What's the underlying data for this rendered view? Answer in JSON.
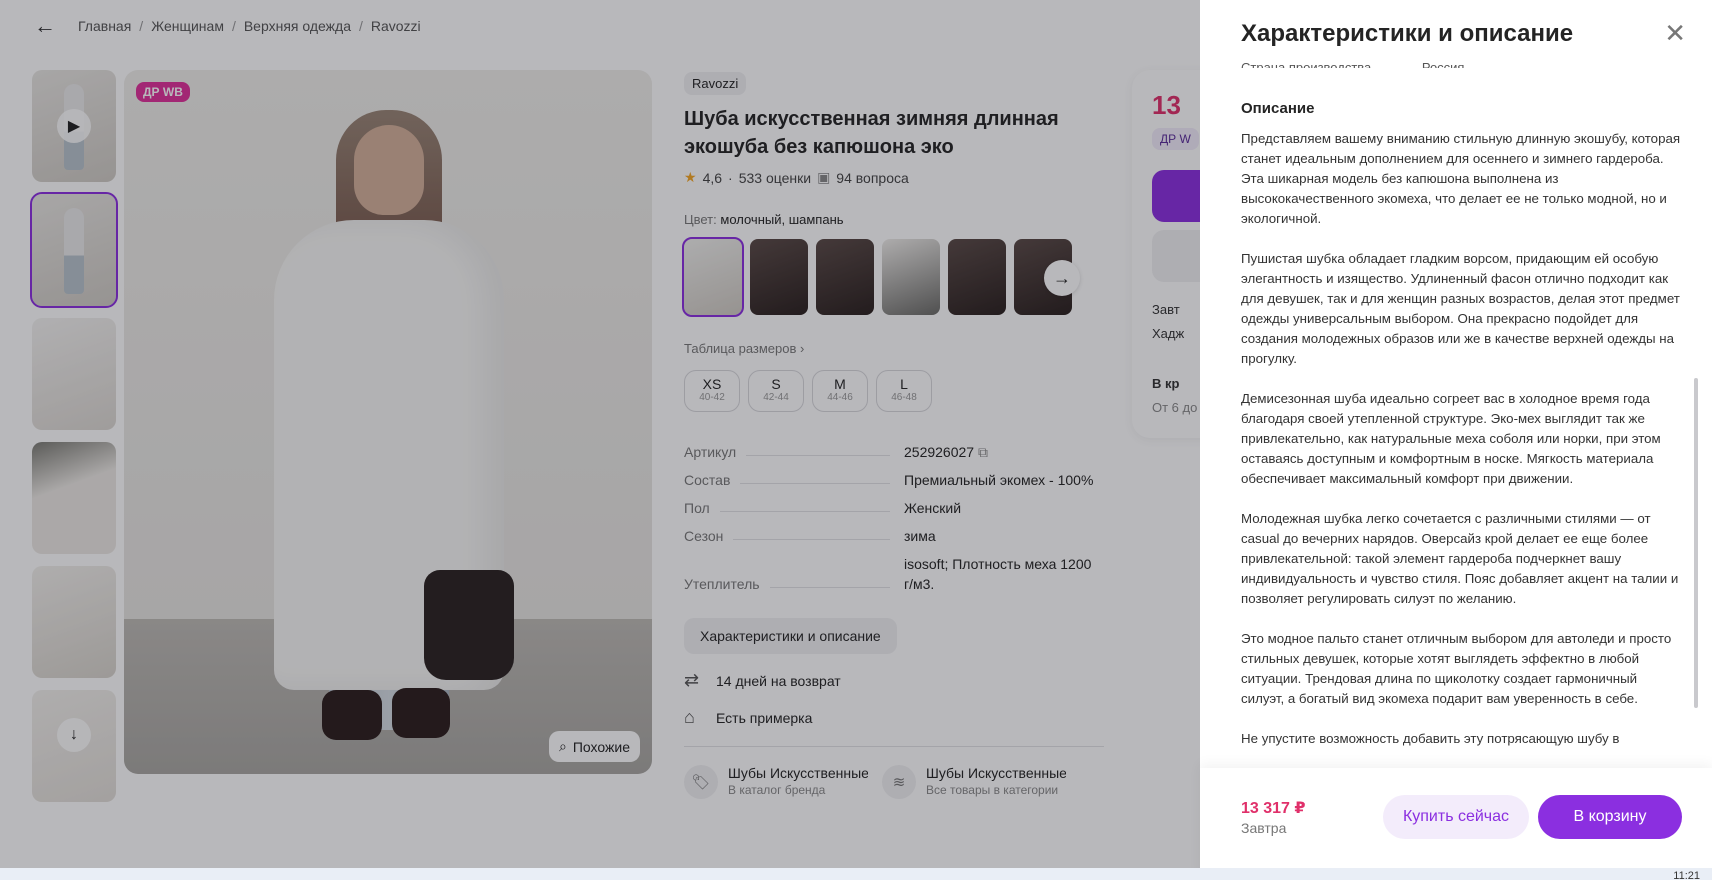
{
  "breadcrumb": [
    "Главная",
    "Женщинам",
    "Верхняя одежда",
    "Ravozzi"
  ],
  "gallery": {
    "badge": "ДР WB",
    "similar_label": "Похожие"
  },
  "product": {
    "brand": "Ravozzi",
    "title": "Шуба искусственная зимняя длинная экошуба без капюшона эко",
    "rating": "4,6",
    "reviews": "533 оценки",
    "questions": "94 вопроса",
    "color_label": "Цвет:",
    "color_value": "молочный, шампань",
    "size_table_label": "Таблица размеров",
    "sizes": [
      {
        "name": "XS",
        "range": "40-42"
      },
      {
        "name": "S",
        "range": "42-44"
      },
      {
        "name": "M",
        "range": "44-46"
      },
      {
        "name": "L",
        "range": "46-48"
      }
    ],
    "specs": [
      {
        "key": "Артикул",
        "value": "252926027"
      },
      {
        "key": "Состав",
        "value": "Премиальный экомех - 100%"
      },
      {
        "key": "Пол",
        "value": "Женский"
      },
      {
        "key": "Сезон",
        "value": "зима"
      },
      {
        "key": "Утеплитель",
        "value": "isosoft; Плотность меха 1200 г/м3."
      }
    ],
    "char_button": "Характеристики и описание",
    "perks": [
      "14 дней на возврат",
      "Есть примерка"
    ],
    "categories": [
      {
        "title": "Шубы Искусственные R",
        "sub": "В каталог бренда"
      },
      {
        "title": "Шубы Искусственные",
        "sub": "Все товары в категории"
      }
    ]
  },
  "buy_card": {
    "price_fragment": "13",
    "dr_fragment": "ДР W",
    "line1": "Завт",
    "line2": "Хадж",
    "line3": "В кр",
    "line4": "От 6 до"
  },
  "panel": {
    "title": "Характеристики и описание",
    "cut_line": "Страна производства ............ Россия",
    "section_title": "Описание",
    "paragraphs": [
      "Представляем вашему вниманию стильную длинную экошубу, которая станет идеальным дополнением для осеннего и зимнего гардероба. Эта шикарная модель без капюшона выполнена из высококачественного экомеха, что делает ее не только модной, но и экологичной.",
      "Пушистая шубка обладает гладким ворсом, придающим ей особую элегантность и изящество. Удлиненный фасон отлично подходит как для девушек, так и для женщин разных возрастов, делая этот предмет одежды универсальным выбором. Она прекрасно подойдет для создания молодежных образов или же в качестве верхней одежды на прогулку.",
      "Демисезонная шуба идеально согреет вас в холодное время года благодаря своей утепленной структуре. Эко-мех выглядит так же привлекательно, как натуральные меха соболя или норки, при этом оставаясь доступным и комфортным в носке. Мягкость материала обеспечивает максимальный комфорт при движении.",
      "Молодежная шубка легко сочетается с различными стилями — от casual до вечерних нарядов. Оверсайз крой делает ее еще более привлекательной: такой элемент гардероба подчеркнет вашу индивидуальность и чувство стиля. Пояс добавляет акцент на талии и позволяет регулировать силуэт по желанию.",
      "Это модное пальто станет отличным выбором для автоледи и просто стильных девушек, которые хотят выглядеть эффектно в любой ситуации. Трендовая длина по щиколотку создает гармоничный силуэт, а богатый вид экомеха подарит вам уверенность в себе.",
      "Не упустите возможность добавить эту потрясающую шубу в"
    ],
    "footer_price": "13 317 ₽",
    "footer_date": "Завтра",
    "buy_now": "Купить сейчас",
    "add_to_cart": "В корзину"
  },
  "taskbar": {
    "clock": "11:21"
  },
  "colors": {
    "accent": "#8b2fe0",
    "price": "#e0306a",
    "badge": "#e0309a"
  }
}
